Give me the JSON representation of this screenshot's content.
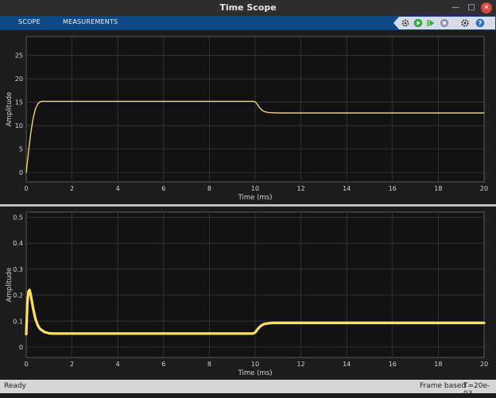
{
  "window": {
    "title": "Time Scope"
  },
  "toolbar": {
    "tabs": [
      {
        "label": "SCOPE"
      },
      {
        "label": "MEASUREMENTS"
      }
    ],
    "icons": [
      "settings-run-icon",
      "run-icon",
      "step-forward-icon",
      "stop-icon",
      "settings-icon",
      "help-icon"
    ]
  },
  "status": {
    "state": "Ready",
    "mode": "Frame based",
    "time": "T=20e-03"
  },
  "colors": {
    "background": "#1c1c1e",
    "axes": "#121214",
    "grid": "#3f3f42",
    "signal": "#ffe066",
    "toolbar": "#0f4a86"
  },
  "chart_data": [
    {
      "type": "line",
      "xlabel": "Time (ms)",
      "ylabel": "Amplitude",
      "xlim": [
        0,
        20
      ],
      "ylim": [
        -2,
        29
      ],
      "xticks": [
        0,
        2,
        4,
        6,
        8,
        10,
        12,
        14,
        16,
        18,
        20
      ],
      "yticks": [
        0,
        5,
        10,
        15,
        20,
        25
      ],
      "grid": true,
      "series": [
        {
          "x": [
            0,
            0.1,
            0.2,
            0.3,
            0.4,
            0.5,
            0.6,
            0.7,
            0.8,
            0.9,
            1.0,
            2,
            4,
            6,
            8,
            9.9,
            10.0,
            10.1,
            10.2,
            10.3,
            10.4,
            10.6,
            11,
            12,
            14,
            16,
            18,
            20
          ],
          "y": [
            0,
            4.5,
            8.5,
            11.5,
            13.5,
            14.6,
            15.1,
            15.2,
            15.2,
            15.2,
            15.2,
            15.2,
            15.2,
            15.2,
            15.2,
            15.2,
            15.1,
            14.5,
            13.8,
            13.3,
            13.0,
            12.8,
            12.7,
            12.7,
            12.7,
            12.7,
            12.7,
            12.7
          ]
        }
      ]
    },
    {
      "type": "line",
      "xlabel": "Time (ms)",
      "ylabel": "Amplitude",
      "xlim": [
        0,
        20
      ],
      "ylim": [
        -0.04,
        0.52
      ],
      "xticks": [
        0,
        2,
        4,
        6,
        8,
        10,
        12,
        14,
        16,
        18,
        20
      ],
      "yticks": [
        0,
        0.1,
        0.2,
        0.3,
        0.4,
        0.5
      ],
      "grid": true,
      "series": [
        {
          "x": [
            0,
            0.05,
            0.1,
            0.15,
            0.2,
            0.3,
            0.4,
            0.5,
            0.6,
            0.8,
            1.0,
            1.2,
            2,
            4,
            6,
            8,
            9.9,
            10.0,
            10.1,
            10.2,
            10.3,
            10.4,
            10.6,
            10.8,
            11,
            12,
            14,
            16,
            18,
            20
          ],
          "y": [
            0.05,
            0.17,
            0.215,
            0.22,
            0.2,
            0.15,
            0.11,
            0.085,
            0.07,
            0.058,
            0.053,
            0.052,
            0.052,
            0.052,
            0.052,
            0.052,
            0.052,
            0.056,
            0.068,
            0.078,
            0.085,
            0.089,
            0.092,
            0.093,
            0.093,
            0.093,
            0.093,
            0.093,
            0.093,
            0.093
          ]
        }
      ]
    }
  ]
}
